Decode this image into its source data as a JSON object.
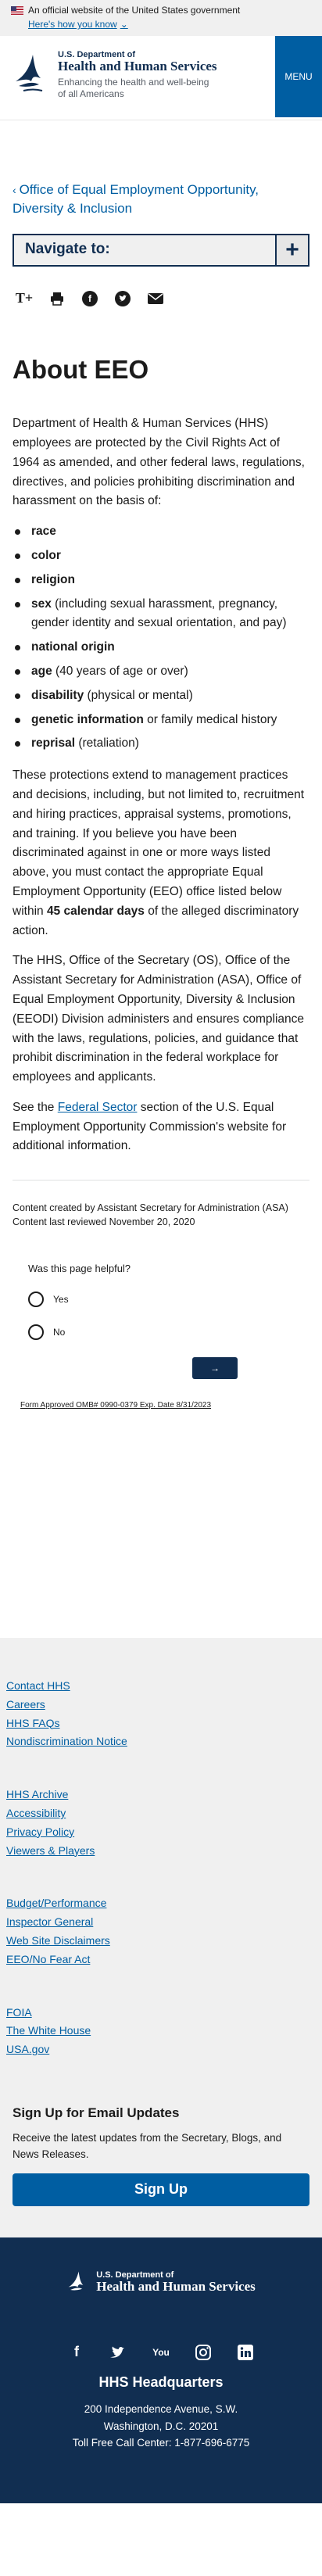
{
  "gov_banner": {
    "text": "An official website of the United States government",
    "how_link": "Here's how you know"
  },
  "header": {
    "dept": "U.S. Department of",
    "name": "Health and Human Services",
    "tagline_1": "Enhancing the health and well-being",
    "tagline_2": "of all Americans",
    "menu_label": "MENU"
  },
  "breadcrumb": {
    "label": "Office of Equal Employment Opportunity, Diversity & Inclusion"
  },
  "navigate": {
    "label": "Navigate to:",
    "plus": "+"
  },
  "share": {
    "text_size": "T+",
    "print": "print-icon",
    "facebook": "facebook-icon",
    "twitter": "twitter-icon",
    "email": "email-icon"
  },
  "page": {
    "title": "About EEO",
    "intro": "Department of Health & Human Services (HHS) employees are protected by the Civil Rights Act of 1964 as amended, and other federal laws, regulations, directives, and policies prohibiting discrimination and harassment on the basis of:",
    "bases": [
      {
        "bold": "race",
        "rest": ""
      },
      {
        "bold": "color",
        "rest": ""
      },
      {
        "bold": "religion",
        "rest": ""
      },
      {
        "bold": "sex",
        "rest": " (including sexual harassment, pregnancy, gender identity and sexual orientation, and pay)"
      },
      {
        "bold": "national origin",
        "rest": ""
      },
      {
        "bold": "age",
        "rest": " (40 years of age or over)"
      },
      {
        "bold": "disability",
        "rest": " (physical or mental)"
      },
      {
        "bold": "genetic information",
        "rest": " or family medical history"
      },
      {
        "bold": "reprisal",
        "rest": " (retaliation)"
      }
    ],
    "para2_a": "These protections extend to management practices and decisions, including, but not limited to, recruitment and hiring practices, appraisal systems, promotions, and training. If you believe you have been discriminated against in one or more ways listed above, you must contact the appropriate Equal Employment Opportunity (EEO) office listed below within ",
    "para2_bold": "45 calendar days",
    "para2_b": " of the alleged discriminatory action.",
    "para3": "The HHS, Office of the Secretary (OS), Office of the Assistant Secretary for Administration (ASA), Office of Equal Employment Opportunity, Diversity & Inclusion (EEODI) Division administers and ensures compliance with the laws, regulations, policies, and guidance that prohibit discrimination in the federal workplace for employees and applicants.",
    "para4_a": "See the ",
    "para4_link": "Federal Sector",
    "para4_b": " section of the U.S. Equal Employment Opportunity Commission's website for additional information."
  },
  "meta": {
    "created": "Content created by Assistant Secretary for Administration (ASA)",
    "reviewed": "Content last reviewed November 20, 2020"
  },
  "feedback": {
    "question": "Was this page helpful?",
    "yes": "Yes",
    "no": "No",
    "submit": "→",
    "omb": "Form Approved OMB# 0990-0379 Exp. Date 8/31/2023"
  },
  "footer": {
    "group1": [
      "Contact HHS",
      "Careers",
      "HHS FAQs",
      "Nondiscrimination Notice"
    ],
    "group2": [
      "HHS Archive",
      "Accessibility",
      "Privacy Policy",
      "Viewers & Players"
    ],
    "group3": [
      "Budget/Performance",
      "Inspector General",
      "Web Site Disclaimers",
      "EEO/No Fear Act"
    ],
    "group4": [
      "FOIA",
      "The White House",
      "USA.gov"
    ],
    "signup_title": "Sign Up for Email Updates",
    "signup_text": "Receive the latest updates from the Secretary, Blogs, and News Releases.",
    "signup_button": "Sign Up"
  },
  "bottom": {
    "dept": "U.S. Department of",
    "name": "Health and Human Services",
    "youtube": "You",
    "hq_title": "HHS Headquarters",
    "addr1": "200 Independence Avenue, S.W.",
    "addr2": "Washington, D.C. 20201",
    "addr3": "Toll Free Call Center: 1-877-696-6775"
  },
  "colors": {
    "primary": "#005ea2",
    "navy": "#112e51",
    "footer_bg": "#f0f0f0"
  }
}
